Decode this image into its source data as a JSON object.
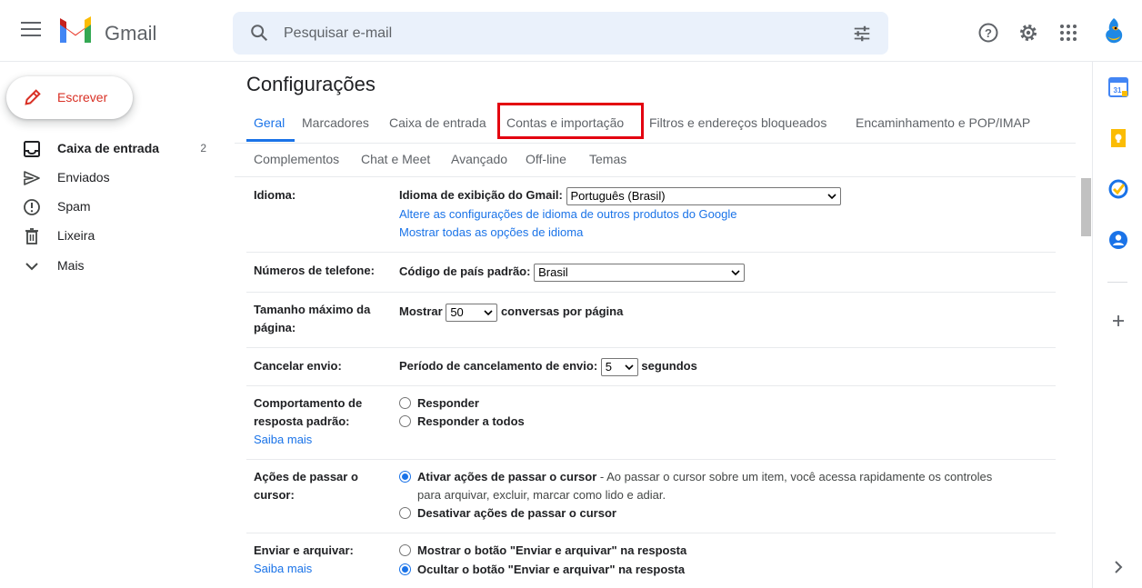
{
  "app": {
    "brand": "Gmail"
  },
  "search": {
    "placeholder": "Pesquisar e-mail"
  },
  "compose": {
    "label": "Escrever"
  },
  "sidebar": {
    "items": [
      {
        "label": "Caixa de entrada",
        "count": "2",
        "icon": "inbox-icon"
      },
      {
        "label": "Enviados",
        "count": "",
        "icon": "send-icon"
      },
      {
        "label": "Spam",
        "count": "",
        "icon": "spam-icon"
      },
      {
        "label": "Lixeira",
        "count": "",
        "icon": "trash-icon"
      },
      {
        "label": "Mais",
        "count": "",
        "icon": "chevron-down-icon"
      }
    ]
  },
  "settings": {
    "title": "Configurações",
    "tabs": [
      "Geral",
      "Marcadores",
      "Caixa de entrada",
      "Contas e importação",
      "Filtros e endereços bloqueados",
      "Encaminhamento e POP/IMAP",
      "Complementos",
      "Chat e Meet",
      "Avançado",
      "Off-line",
      "Temas"
    ],
    "active_tab": "Geral",
    "highlighted_tab": "Contas e importação",
    "language": {
      "label": "Idioma:",
      "display_label": "Idioma de exibição do Gmail:",
      "selected": "Português (Brasil)",
      "link1": "Altere as configurações de idioma de outros produtos do Google",
      "link2": "Mostrar todas as opções de idioma"
    },
    "phone": {
      "label": "Números de telefone:",
      "country_label": "Código de país padrão:",
      "selected": "Brasil"
    },
    "page_size": {
      "label": "Tamanho máximo da página:",
      "show": "Mostrar",
      "selected": "50",
      "suffix": "conversas por página"
    },
    "undo_send": {
      "label": "Cancelar envio:",
      "period_label": "Período de cancelamento de envio:",
      "selected": "5",
      "suffix": "segundos"
    },
    "reply": {
      "label": "Comportamento de resposta padrão:",
      "learn_more": "Saiba mais",
      "option1": "Responder",
      "option2": "Responder a todos"
    },
    "hover": {
      "label": "Ações de passar o cursor:",
      "option1": "Ativar ações de passar o cursor",
      "option1_desc_a": " - Ao passar o cursor sobre um item, você acessa rapidamente os controles",
      "option1_desc_b": "para arquivar, excluir, marcar como lido e adiar.",
      "option2": "Desativar ações de passar o cursor"
    },
    "send_archive": {
      "label": "Enviar e arquivar:",
      "learn_more": "Saiba mais",
      "option1": "Mostrar o botão \"Enviar e arquivar\" na resposta",
      "option2": "Ocultar o botão \"Enviar e arquivar\" na resposta"
    }
  },
  "colors": {
    "accent": "#1a73e8",
    "highlight_box": "#e3000f",
    "compose_text": "#d93025"
  }
}
